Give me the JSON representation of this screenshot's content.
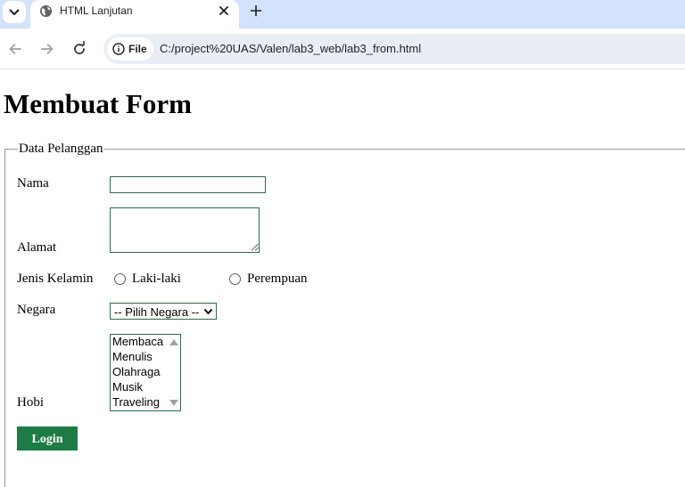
{
  "browser": {
    "tab_title": "HTML Lanjutan",
    "site_chip_label": "File",
    "url": "C:/project%20UAS/Valen/lab3_web/lab3_from.html"
  },
  "page": {
    "title": "Membuat Form",
    "legend": "Data Pelanggan",
    "fields": {
      "nama_label": "Nama",
      "nama_value": "",
      "alamat_label": "Alamat",
      "alamat_value": "",
      "gender_label": "Jenis Kelamin",
      "gender_options": [
        "Laki-laki",
        "Perempuan"
      ],
      "negara_label": "Negara",
      "negara_selected": "-- Pilih Negara --",
      "hobi_label": "Hobi",
      "hobi_options": [
        "Membaca",
        "Menulis",
        "Olahraga",
        "Musik",
        "Traveling"
      ]
    },
    "login_label": "Login"
  },
  "colors": {
    "input_border": "#2e6b4a",
    "button_bg": "#1e7b46",
    "tabstrip_bg": "#d3e3fd",
    "omnibox_bg": "#e9eef6"
  },
  "icons": [
    "tab-search-icon",
    "globe-icon",
    "close-icon",
    "plus-icon",
    "back-arrow-icon",
    "forward-arrow-icon",
    "reload-icon",
    "info-icon",
    "chevron-down-icon",
    "scroll-up-icon",
    "scroll-down-icon"
  ]
}
